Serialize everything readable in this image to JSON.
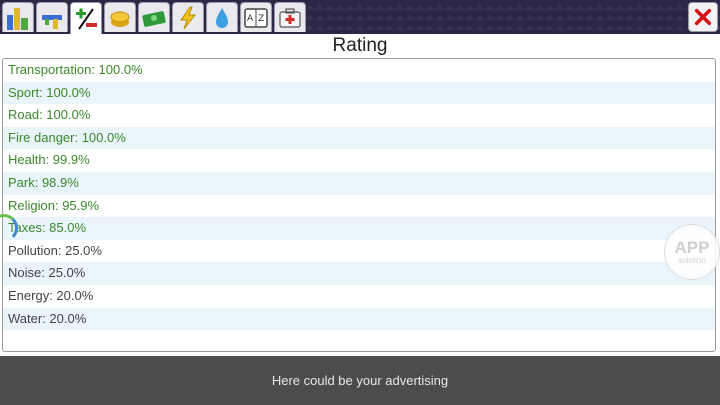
{
  "toolbar": {
    "tabs": [
      {
        "icon": "city-buildings-icon"
      },
      {
        "icon": "level-bars-icon"
      },
      {
        "icon": "plus-minus-icon",
        "active": true
      },
      {
        "icon": "coins-icon"
      },
      {
        "icon": "cash-icon"
      },
      {
        "icon": "lightning-icon"
      },
      {
        "icon": "water-drop-icon"
      },
      {
        "icon": "book-az-icon"
      },
      {
        "icon": "medical-kit-icon"
      }
    ],
    "close_icon": "close-icon"
  },
  "panel": {
    "title": "Rating",
    "ratings": [
      {
        "label": "Transportation: 100.0%"
      },
      {
        "label": "Sport: 100.0%"
      },
      {
        "label": "Road: 100.0%"
      },
      {
        "label": "Fire danger: 100.0%"
      },
      {
        "label": "Health: 99.9%"
      },
      {
        "label": "Park: 98.9%"
      },
      {
        "label": "Religion: 95.9%"
      },
      {
        "label": "Taxes: 85.0%"
      },
      {
        "label": "Pollution: 25.0%"
      },
      {
        "label": "Noise: 25.0%"
      },
      {
        "label": "Energy: 20.0%"
      },
      {
        "label": "Water: 20.0%"
      }
    ]
  },
  "watermark": {
    "line1": "APP",
    "line2": "solution"
  },
  "ad": {
    "text": "Here could be your advertising"
  },
  "colors": {
    "good": "#3a8a2a",
    "bad": "#444444",
    "stripe": "#eaf4fb",
    "close": "#d01818"
  }
}
